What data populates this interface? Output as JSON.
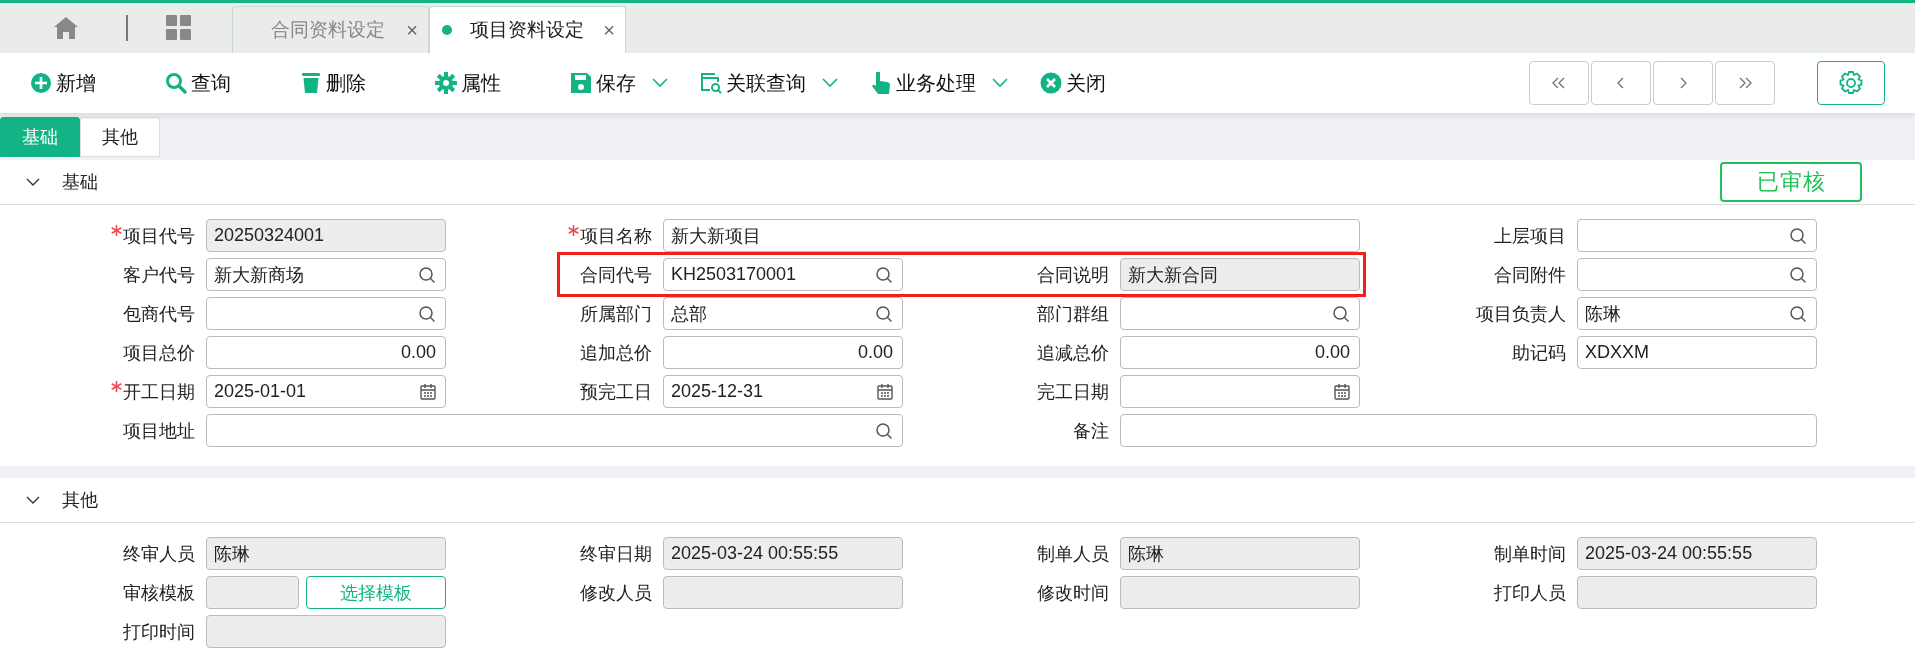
{
  "tabs": [
    {
      "label": "合同资料设定",
      "selected": false,
      "close": "×"
    },
    {
      "label": "项目资料设定",
      "selected": true,
      "close": "×"
    }
  ],
  "toolbar": [
    {
      "label": "新增",
      "kind": "add",
      "dropdown": false
    },
    {
      "label": "查询",
      "kind": "search",
      "dropdown": false
    },
    {
      "label": "删除",
      "kind": "delete",
      "dropdown": false
    },
    {
      "label": "属性",
      "kind": "settings",
      "dropdown": false
    },
    {
      "label": "保存",
      "kind": "save",
      "dropdown": true
    },
    {
      "label": "关联查询",
      "kind": "related",
      "dropdown": true
    },
    {
      "label": "业务处理",
      "kind": "process",
      "dropdown": true
    },
    {
      "label": "关闭",
      "kind": "close",
      "dropdown": false
    }
  ],
  "subtabs": [
    {
      "label": "基础",
      "selected": true
    },
    {
      "label": "其他",
      "selected": false
    }
  ],
  "sections": [
    {
      "title": "基础",
      "expanded": true,
      "status_badge": "已审核",
      "rows": [
        [
          {
            "label": "项目代号",
            "value": "20250324001",
            "kind": "text",
            "required": true,
            "disabled": true,
            "highlighted": false
          },
          {
            "label": "项目名称",
            "value": "新大新项目",
            "kind": "text",
            "required": true,
            "disabled": false,
            "highlighted": false
          },
          "",
          {
            "label": "上层项目",
            "kind": "search",
            "required": false,
            "disabled": false,
            "highlighted": false
          }
        ],
        [
          {
            "label": "客户代号",
            "value": "新大新商场",
            "kind": "search",
            "required": false,
            "disabled": false,
            "highlighted": false
          },
          {
            "label": "合同代号",
            "value": "KH2503170001",
            "kind": "search",
            "required": false,
            "disabled": false,
            "highlighted": true
          },
          {
            "label": "合同说明",
            "value": "新大新合同",
            "kind": "text",
            "required": false,
            "disabled": true,
            "highlighted": true
          },
          {
            "label": "合同附件",
            "kind": "search",
            "required": false,
            "disabled": false,
            "highlighted": false
          }
        ],
        [
          {
            "label": "包商代号",
            "kind": "search",
            "required": false,
            "disabled": false,
            "highlighted": false
          },
          {
            "label": "所属部门",
            "value": "总部",
            "kind": "search",
            "required": false,
            "disabled": false,
            "highlighted": false
          },
          {
            "label": "部门群组",
            "kind": "search",
            "required": false,
            "disabled": false,
            "highlighted": false
          },
          {
            "label": "项目负责人",
            "value": "陈琳",
            "kind": "search",
            "required": false,
            "disabled": false,
            "highlighted": false
          }
        ],
        [
          {
            "label": "项目总价",
            "value": "0.00",
            "kind": "number",
            "required": false,
            "disabled": false,
            "highlighted": false
          },
          {
            "label": "追加总价",
            "value": "0.00",
            "kind": "number",
            "required": false,
            "disabled": false,
            "highlighted": false
          },
          {
            "label": "追减总价",
            "value": "0.00",
            "kind": "number",
            "required": false,
            "disabled": false,
            "highlighted": false
          },
          {
            "label": "助记码",
            "value": "XDXXM",
            "kind": "text",
            "required": false,
            "disabled": false,
            "highlighted": false
          }
        ],
        [
          {
            "label": "开工日期",
            "value": "2025-01-01",
            "kind": "date",
            "required": true,
            "disabled": false,
            "highlighted": false
          },
          {
            "label": "预完工日",
            "value": "2025-12-31",
            "kind": "date",
            "required": false,
            "disabled": false,
            "highlighted": false
          },
          {
            "label": "完工日期",
            "kind": "date",
            "required": false,
            "disabled": false,
            "highlighted": false
          }
        ],
        [
          {
            "label": "项目地址",
            "kind": "search",
            "required": false,
            "disabled": false,
            "highlighted": false
          },
          "",
          {
            "label": "备注",
            "kind": "text",
            "required": false,
            "disabled": false,
            "highlighted": false
          },
          ""
        ]
      ]
    },
    {
      "title": "其他",
      "expanded": true,
      "rows": [
        [
          {
            "label": "终审人员",
            "value": "陈琳",
            "kind": "text",
            "required": false,
            "disabled": true,
            "highlighted": false
          },
          {
            "label": "终审日期",
            "value": "2025-03-24 00:55:55",
            "kind": "text",
            "required": false,
            "disabled": true,
            "highlighted": false
          },
          {
            "label": "制单人员",
            "value": "陈琳",
            "kind": "text",
            "required": false,
            "disabled": true,
            "highlighted": false
          },
          {
            "label": "制单时间",
            "value": "2025-03-24 00:55:55",
            "kind": "text",
            "required": false,
            "disabled": true,
            "highlighted": false
          }
        ],
        [
          {
            "label": "审核模板",
            "kind": "template",
            "button": "选择模板",
            "required": false,
            "disabled": true,
            "highlighted": false
          },
          {
            "label": "修改人员",
            "kind": "text",
            "required": false,
            "disabled": true,
            "highlighted": false
          },
          {
            "label": "修改时间",
            "kind": "text",
            "required": false,
            "disabled": true,
            "highlighted": false
          },
          {
            "label": "打印人员",
            "kind": "text",
            "required": false,
            "disabled": true,
            "highlighted": false
          }
        ],
        [
          {
            "label": "打印时间",
            "kind": "text",
            "required": false,
            "disabled": true,
            "highlighted": false
          }
        ]
      ]
    }
  ]
}
